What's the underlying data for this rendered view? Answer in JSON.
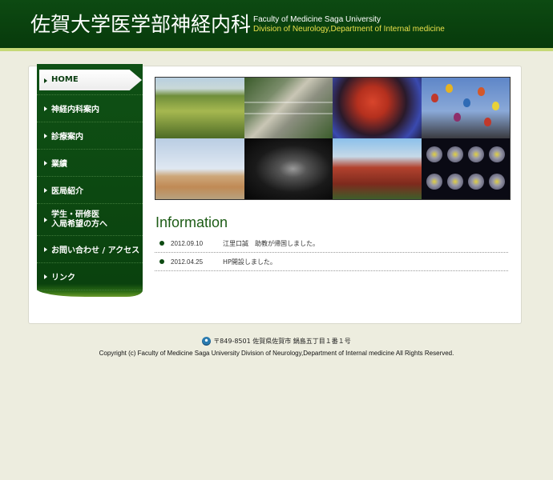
{
  "header": {
    "title": "佐賀大学医学部神経内科",
    "subtitle_line1": "Faculty of Medicine Saga University",
    "subtitle_line2": "Division of Neurology,Department of Internal medicine"
  },
  "sidebar": {
    "items": [
      {
        "label": "HOME",
        "active": true
      },
      {
        "label": "神経内科案内"
      },
      {
        "label": "診療案内"
      },
      {
        "label": "業績"
      },
      {
        "label": "医局紹介"
      },
      {
        "label_line1": "学生・研修医",
        "label_line2": "入局希望の方へ"
      },
      {
        "label": "お問い合わせ / アクセス"
      },
      {
        "label": "リンク"
      }
    ]
  },
  "mosaic": {
    "images": [
      "rice-field",
      "campus-aerial",
      "festival-float",
      "hot-air-balloons",
      "watchtower",
      "spine-mri",
      "shrine-bridge",
      "brain-scan"
    ]
  },
  "information": {
    "title": "Information",
    "news": [
      {
        "date": "2012.09.10",
        "text": "江里口誠　助教が帰国しました。"
      },
      {
        "date": "2012.04.25",
        "text": "HP開設しました。"
      }
    ]
  },
  "footer": {
    "address": "〒849-8501 佐賀県佐賀市 鍋島五丁目１番１号",
    "copyright": "Copyright (c) Faculty of Medicine Saga University Division of Neurology,Department of Internal medicine All Rights Reserved."
  },
  "colors": {
    "header_green": "#0d4a12",
    "accent_yellow": "#e8e04a",
    "info_title_green": "#1d5c16",
    "page_bg": "#ededdf"
  }
}
